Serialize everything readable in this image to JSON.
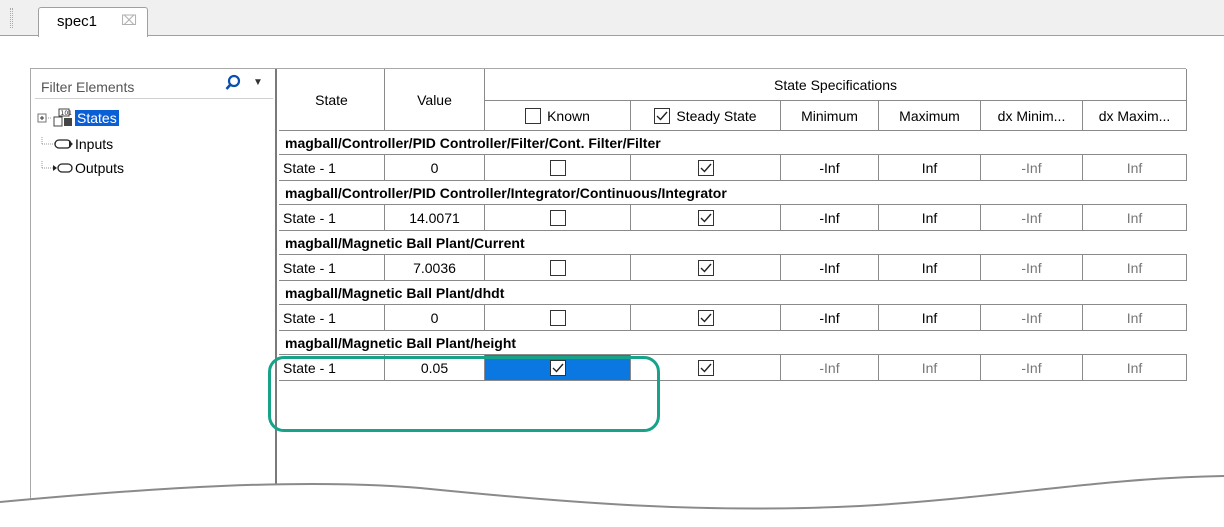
{
  "tab": {
    "label": "spec1",
    "close_glyph": "⌧"
  },
  "tree": {
    "filter_placeholder": "Filter Elements",
    "items": [
      {
        "label": "States",
        "selected": true,
        "icon": "states-icon"
      },
      {
        "label": "Inputs",
        "icon": "input-port-icon"
      },
      {
        "label": "Outputs",
        "icon": "output-port-icon"
      }
    ]
  },
  "table": {
    "col_state": "State",
    "col_value": "Value",
    "group_header": "State Specifications",
    "col_known": "Known",
    "col_steady": "Steady State",
    "col_min": "Minimum",
    "col_max": "Maximum",
    "col_dxmin": "dx Minim...",
    "col_dxmax": "dx Maxim...",
    "groups": [
      {
        "path": "magball/Controller/PID Controller/Filter/Cont. Filter/Filter",
        "row": {
          "state": "State - 1",
          "value": "0",
          "known": false,
          "steady": true,
          "min": "-Inf",
          "max": "Inf",
          "dxmin": "-Inf",
          "dxmax": "Inf"
        }
      },
      {
        "path": "magball/Controller/PID Controller/Integrator/Continuous/Integrator",
        "row": {
          "state": "State - 1",
          "value": "14.0071",
          "known": false,
          "steady": true,
          "min": "-Inf",
          "max": "Inf",
          "dxmin": "-Inf",
          "dxmax": "Inf"
        }
      },
      {
        "path": "magball/Magnetic Ball Plant/Current",
        "row": {
          "state": "State - 1",
          "value": "7.0036",
          "known": false,
          "steady": true,
          "min": "-Inf",
          "max": "Inf",
          "dxmin": "-Inf",
          "dxmax": "Inf"
        }
      },
      {
        "path": "magball/Magnetic Ball Plant/dhdt",
        "row": {
          "state": "State - 1",
          "value": "0",
          "known": false,
          "steady": true,
          "min": "-Inf",
          "max": "Inf",
          "dxmin": "-Inf",
          "dxmax": "Inf"
        }
      },
      {
        "path": "magball/Magnetic Ball Plant/height",
        "row": {
          "state": "State - 1",
          "value": "0.05",
          "known": true,
          "steady": true,
          "min": "-Inf",
          "max": "Inf",
          "dxmin": "-Inf",
          "dxmax": "Inf"
        }
      }
    ]
  },
  "colors": {
    "selection": "#0a78e0",
    "highlight_ring": "#17a28a",
    "tree_selection": "#0a5fd6"
  }
}
